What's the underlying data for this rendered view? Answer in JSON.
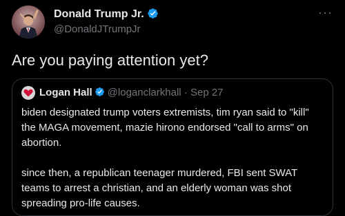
{
  "tweet": {
    "display_name": "Donald Trump Jr.",
    "handle": "@DonaldJTrumpJr",
    "more_label": "···",
    "text": "Are you paying attention yet?"
  },
  "quote": {
    "display_name": "Logan Hall",
    "handle": "@loganclarkhall",
    "separator": "·",
    "date": "Sep 27",
    "paragraphs": [
      "biden designated trump voters extremists, tim ryan said to \"kill\" the MAGA movement, mazie hirono endorsed \"call to arms\" on abortion.",
      "since then, a republican teenager murdered, FBI sent SWAT teams to arrest a christian, and an elderly woman was shot spreading pro-life causes."
    ]
  },
  "colors": {
    "background": "#000000",
    "text": "#e7e9ea",
    "muted": "#71767b",
    "verified": "#1d9bf0",
    "border": "#2f3336"
  },
  "icons": [
    "avatar-photo",
    "verified-badge-icon",
    "more-options-icon"
  ]
}
